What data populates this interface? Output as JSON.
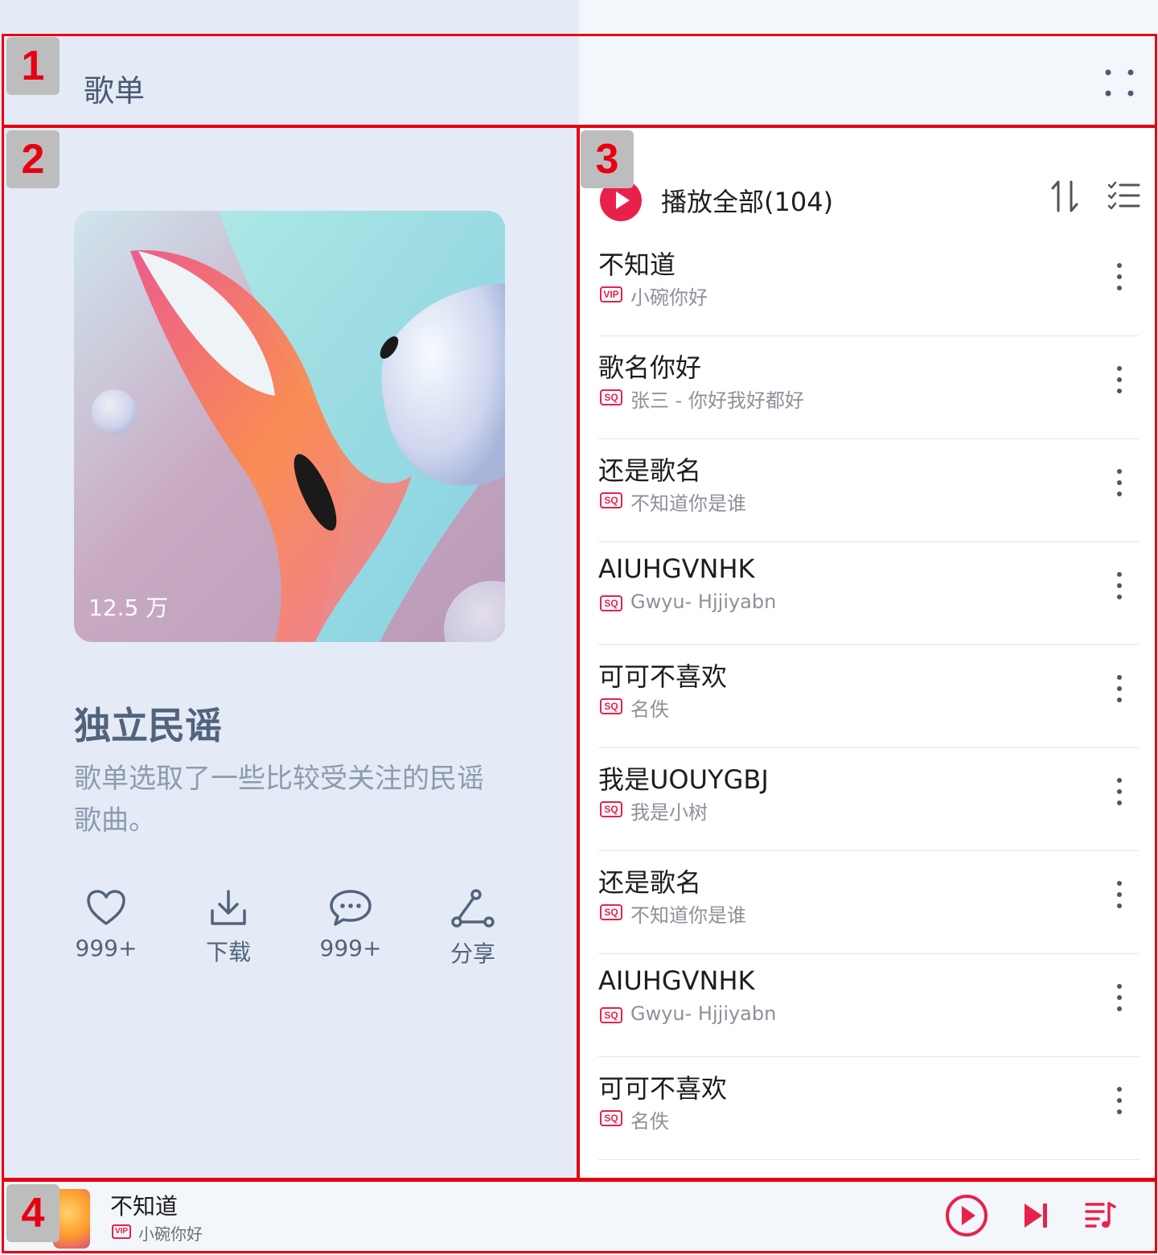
{
  "header": {
    "title": "歌单"
  },
  "regions": [
    "1",
    "2",
    "3",
    "4"
  ],
  "playlist": {
    "play_count": "12.5 万",
    "name": "独立民谣",
    "description": "歌单选取了一些比较受关注的民谣歌曲。",
    "actions": [
      {
        "icon": "heart-icon",
        "label": "999+"
      },
      {
        "icon": "download-icon",
        "label": "下载"
      },
      {
        "icon": "comment-icon",
        "label": "999+"
      },
      {
        "icon": "share-icon",
        "label": "分享"
      }
    ]
  },
  "song_list": {
    "play_all_label": "播放全部(104)",
    "songs": [
      {
        "title": "不知道",
        "badge": "VIP",
        "subtitle": "小碗你好"
      },
      {
        "title": "歌名你好",
        "badge": "SQ",
        "subtitle": "张三 - 你好我好都好"
      },
      {
        "title": "还是歌名",
        "badge": "SQ",
        "subtitle": "不知道你是谁"
      },
      {
        "title": "AIUHGVNHK",
        "badge": "SQ",
        "subtitle": "Gwyu- Hjjiyabn"
      },
      {
        "title": "可可不喜欢",
        "badge": "SQ",
        "subtitle": "名佚"
      },
      {
        "title": "我是UOUYGBJ",
        "badge": "SQ",
        "subtitle": "我是小树"
      },
      {
        "title": "还是歌名",
        "badge": "SQ",
        "subtitle": "不知道你是谁"
      },
      {
        "title": "AIUHGVNHK",
        "badge": "SQ",
        "subtitle": "Gwyu- Hjjiyabn"
      },
      {
        "title": "可可不喜欢",
        "badge": "SQ",
        "subtitle": "名佚"
      }
    ]
  },
  "mini_player": {
    "title": "不知道",
    "badge": "VIP",
    "subtitle": "小碗你好"
  },
  "colors": {
    "accent": "#e8214b",
    "annotation": "#e60012",
    "left_bg": "#e4ebf6",
    "text_muted": "#8d9bb0"
  }
}
